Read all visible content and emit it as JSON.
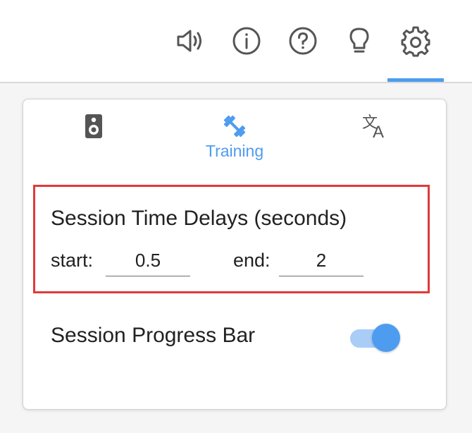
{
  "topbar": {
    "icons": [
      "speaker-icon",
      "info-icon",
      "help-icon",
      "lightbulb-icon",
      "gear-icon"
    ],
    "active_icon": "gear-icon",
    "icon_color": "#555555",
    "accent_color": "#4d9cf0"
  },
  "tabs": [
    {
      "icon": "speaker-device-icon",
      "label": ""
    },
    {
      "icon": "dumbbell-icon",
      "label": "Training",
      "active": true
    },
    {
      "icon": "translate-icon",
      "label": ""
    }
  ],
  "session_delays": {
    "title": "Session Time Delays (seconds)",
    "start_label": "start:",
    "start_value": "0.5",
    "end_label": "end:",
    "end_value": "2",
    "highlight_color": "#e03a3a"
  },
  "progress_bar": {
    "label": "Session Progress Bar",
    "enabled": true
  }
}
